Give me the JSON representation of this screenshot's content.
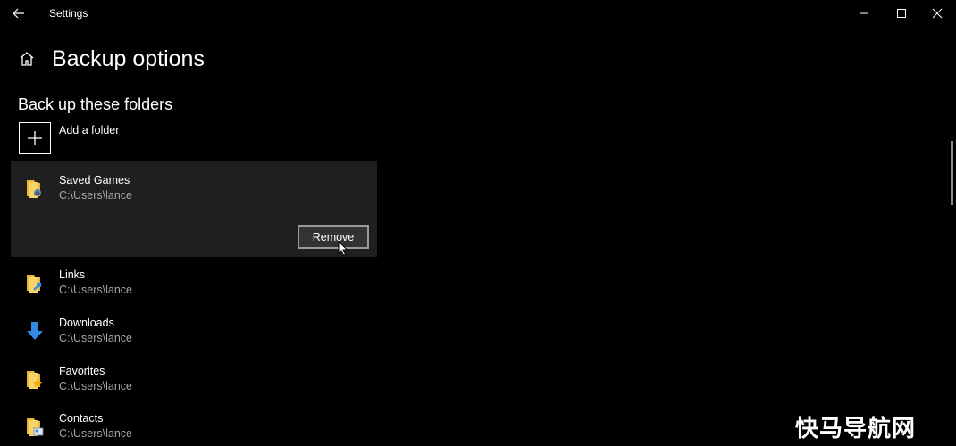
{
  "window": {
    "title": "Settings",
    "back_icon": "back-arrow-icon",
    "controls": [
      "minimize-icon",
      "maximize-icon",
      "close-icon"
    ]
  },
  "header": {
    "title": "Backup options",
    "icon": "home-icon"
  },
  "section": {
    "title": "Back up these folders",
    "add_label": "Add a folder"
  },
  "folders": [
    {
      "name": "Saved Games",
      "path": "C:\\Users\\lance",
      "icon": "saved-games-folder-icon",
      "selected": true
    },
    {
      "name": "Links",
      "path": "C:\\Users\\lance",
      "icon": "links-folder-icon"
    },
    {
      "name": "Downloads",
      "path": "C:\\Users\\lance",
      "icon": "downloads-arrow-icon"
    },
    {
      "name": "Favorites",
      "path": "C:\\Users\\lance",
      "icon": "favorites-folder-icon"
    },
    {
      "name": "Contacts",
      "path": "C:\\Users\\lance",
      "icon": "contacts-folder-icon"
    }
  ],
  "remove_label": "Remove",
  "watermark": "快马导航网",
  "colors": {
    "background": "#000000",
    "selected_panel": "#1f1f1f",
    "secondary_text": "#a6a6a6",
    "folder_yellow": "#f4c542",
    "accent_blue": "#2f8ae0"
  }
}
